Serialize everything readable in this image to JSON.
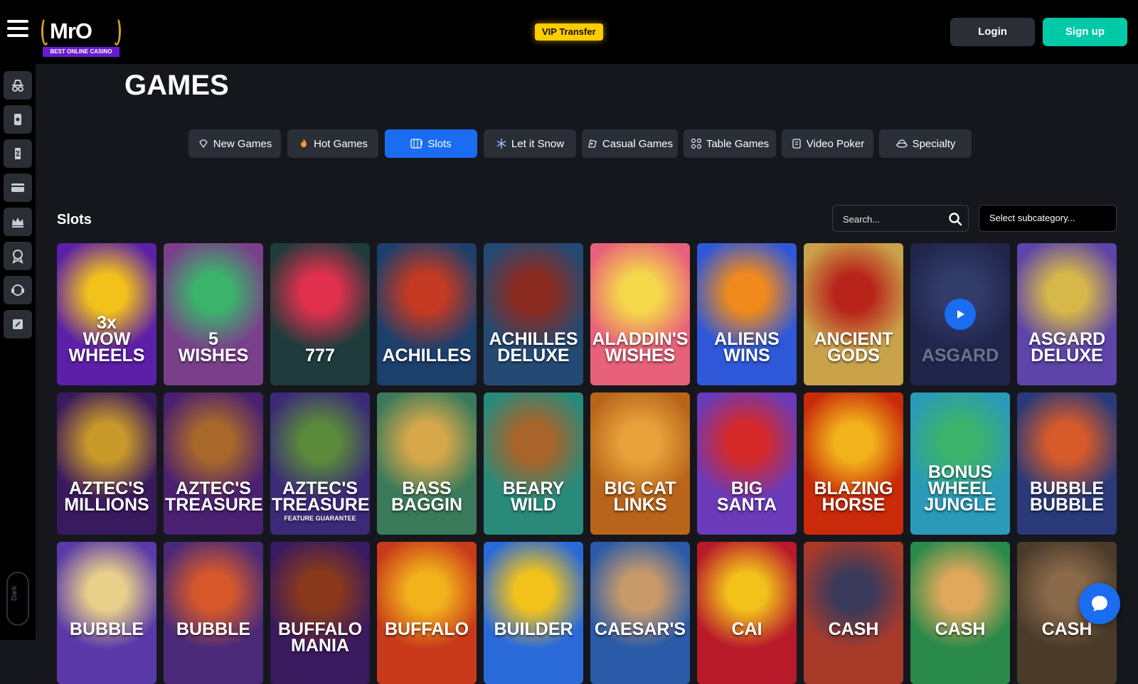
{
  "header": {
    "logo": {
      "text": "MrO",
      "tagline": "BEST ONLINE CASINO"
    },
    "vip_label": "VIP Transfer",
    "login_label": "Login",
    "signup_label": "Sign up"
  },
  "sidebar": {
    "items": [
      {
        "icon": "incognito-icon"
      },
      {
        "icon": "slot-icon"
      },
      {
        "icon": "percent-tag-icon"
      },
      {
        "icon": "card-icon"
      },
      {
        "icon": "crown-icon"
      },
      {
        "icon": "badge-icon"
      },
      {
        "icon": "support-icon"
      },
      {
        "icon": "edit-icon"
      }
    ],
    "dark_label": "Dark"
  },
  "page": {
    "title": "GAMES"
  },
  "tabs": [
    {
      "label": "New Games",
      "icon": "diamond-icon",
      "active": false
    },
    {
      "label": "Hot Games",
      "icon": "fire-icon",
      "active": false
    },
    {
      "label": "Slots",
      "icon": "slot-machine-icon",
      "active": true
    },
    {
      "label": "Let it Snow",
      "icon": "snowflake-icon",
      "active": false
    },
    {
      "label": "Casual Games",
      "icon": "casual-icon",
      "active": false
    },
    {
      "label": "Table Games",
      "icon": "table-games-icon",
      "active": false
    },
    {
      "label": "Video Poker",
      "icon": "video-poker-icon",
      "active": false
    },
    {
      "label": "Specialty",
      "icon": "specialty-icon",
      "active": false
    }
  ],
  "section": {
    "title": "Slots",
    "search_placeholder": "Search...",
    "subcategory_label": "Select subcategory..."
  },
  "games": [
    {
      "name": "3x\nWOW\nWHEELS",
      "bg": "#5b1fa8",
      "accent": "#f2c21b"
    },
    {
      "name": "5\nWISHES",
      "bg": "#7a3f8a",
      "accent": "#3cb36b"
    },
    {
      "name": "777",
      "bg": "#1f3b3b",
      "accent": "#e0304e"
    },
    {
      "name": "ACHILLES",
      "bg": "#1d3f6b",
      "accent": "#c43a22"
    },
    {
      "name": "ACHILLES\nDELUXE",
      "bg": "#244a74",
      "accent": "#8a2a1f"
    },
    {
      "name": "ALADDIN'S\nWISHES",
      "bg": "#e8617a",
      "accent": "#f5d84a"
    },
    {
      "name": "ALIENS\nWINS",
      "bg": "#2f58d8",
      "accent": "#f08a1c"
    },
    {
      "name": "ANCIENT\nGODS",
      "bg": "#c9a24a",
      "accent": "#b8241a"
    },
    {
      "name": "ASGARD",
      "bg": "#283070",
      "accent": "#4a5aa8",
      "playing": true
    },
    {
      "name": "ASGARD\nDELUXE",
      "bg": "#5c44a8",
      "accent": "#d6b84a"
    },
    {
      "name": "AZTEC'S\nMILLIONS",
      "bg": "#3a1a5e",
      "accent": "#c89a2a"
    },
    {
      "name": "AZTEC'S\nTREASURE",
      "bg": "#4a2070",
      "accent": "#a8682a"
    },
    {
      "name": "AZTEC'S\nTREASURE",
      "bg": "#3a2a78",
      "accent": "#5a8a3a",
      "sub": "FEATURE GUARANTEE"
    },
    {
      "name": "BASS\nBAGGIN",
      "bg": "#3a7a5a",
      "accent": "#d6a84a"
    },
    {
      "name": "BEARY\nWILD",
      "bg": "#2a8a7a",
      "accent": "#a8642a"
    },
    {
      "name": "BIG CAT\nLINKS",
      "bg": "#b8641a",
      "accent": "#e8a23a"
    },
    {
      "name": "BIG\nSANTA",
      "bg": "#6a3ab8",
      "accent": "#d62a2a"
    },
    {
      "name": "BLAZING\nHORSE",
      "bg": "#c82a0a",
      "accent": "#f2b21b"
    },
    {
      "name": "BONUS WHEEL\nJUNGLE",
      "bg": "#2a9ab8",
      "accent": "#3cb36b"
    },
    {
      "name": "BUBBLE\nBUBBLE",
      "bg": "#2a3a78",
      "accent": "#d65a2a"
    },
    {
      "name": "BUBBLE",
      "bg": "#5a3aa8",
      "accent": "#e8d08a"
    },
    {
      "name": "BUBBLE",
      "bg": "#4a2a78",
      "accent": "#d6582a"
    },
    {
      "name": "BUFFALO\nMANIA",
      "bg": "#3a1a5e",
      "accent": "#8a3a1a"
    },
    {
      "name": "BUFFALO",
      "bg": "#c83a1a",
      "accent": "#f2b21b"
    },
    {
      "name": "BUILDER",
      "bg": "#2a6ad8",
      "accent": "#f2c21b"
    },
    {
      "name": "CAESAR'S",
      "bg": "#2a5aa8",
      "accent": "#c89a6a"
    },
    {
      "name": "CAI",
      "bg": "#b81a2a",
      "accent": "#f2c21b"
    },
    {
      "name": "CASH",
      "bg": "#a83a2a",
      "accent": "#3a3a5a"
    },
    {
      "name": "CASH",
      "bg": "#2a8a4a",
      "accent": "#e0a85a"
    },
    {
      "name": "CASH",
      "bg": "#4a3a2a",
      "accent": "#8a6a4a"
    }
  ]
}
